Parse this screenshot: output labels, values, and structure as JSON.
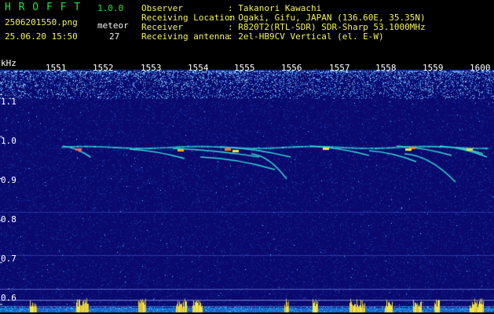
{
  "header": {
    "app_name": "H R O F F T",
    "version": "1.0.0",
    "filename": "2506201550.png",
    "datetime": "25.06.20 15:50",
    "meteor_label": "meteor",
    "meteor_count": "27",
    "info_labels": [
      "Observer",
      "Receiving Location",
      "Receiver",
      "Receiving antenna"
    ],
    "info_values": [
      ": Takanori Kawachi",
      ": Ogaki, Gifu, JAPAN (136.60E, 35.35N)",
      ": R820T2(RTL-SDR) SDR-Sharp 53.1000MHz",
      ": 2el-HB9CV Vertical (el. E-W)"
    ]
  },
  "axis": {
    "unit": "kHz",
    "time_ticks": [
      "1551",
      "1552",
      "1553",
      "1554",
      "1555",
      "1556",
      "1557",
      "1558",
      "1559",
      "1600"
    ],
    "freq_ticks": [
      "1.1",
      "1.0",
      "0.9",
      "0.8",
      "0.7",
      "0.6"
    ],
    "freq_values": [
      1.1,
      1.0,
      0.9,
      0.8,
      0.7,
      0.6
    ],
    "freq_range": [
      0.58,
      1.16
    ]
  },
  "colors": {
    "background": "#0a0a6e",
    "header_green": "#29e23a",
    "header_white": "#f2f2f2",
    "header_yellow": "#f4f25a",
    "carrier": "#38d4d4",
    "meteor_hot": "#ff7a1a",
    "meteor_warm": "#f4e84a"
  }
}
